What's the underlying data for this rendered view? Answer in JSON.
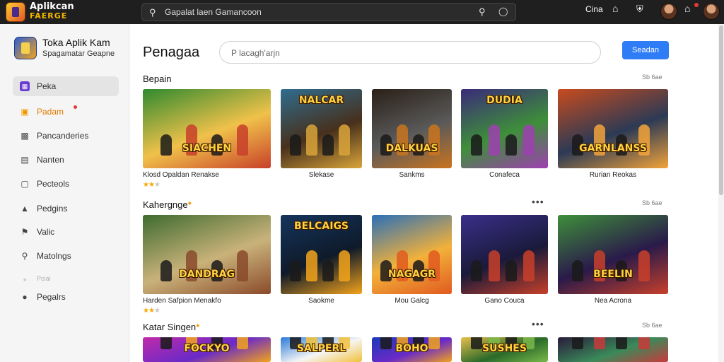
{
  "topbar": {
    "brand_line1": "Aplikcan",
    "brand_line2": "FAERGE",
    "search_text": "Gapalat laen Gamancoon",
    "right_label": "Cina"
  },
  "sidebar": {
    "app_name": "Toka Aplik Kam",
    "app_subtitle": "Spagamatar Geapne",
    "items": [
      {
        "label": "Peka",
        "icon": "grid-icon"
      },
      {
        "label": "Padam",
        "icon": "fire-icon"
      },
      {
        "label": "Pancanderies",
        "icon": "folder-icon"
      },
      {
        "label": "Nanten",
        "icon": "calendar-icon"
      },
      {
        "label": "Pecteols",
        "icon": "document-icon"
      },
      {
        "label": "Pedgins",
        "icon": "puzzle-icon"
      },
      {
        "label": "Valic",
        "icon": "flag-icon"
      },
      {
        "label": "Matolngs",
        "icon": "search-icon"
      },
      {
        "label": "Pcial",
        "icon": "circle-icon"
      },
      {
        "label": "Pegalrs",
        "icon": "settings-icon"
      }
    ]
  },
  "main": {
    "page_title": "Penagaa",
    "search_placeholder": "P lacagh'arjn",
    "search_button": "Seadan",
    "sections": [
      {
        "title": "Bepain",
        "see_all": "Sb 6ae",
        "more": "",
        "cards": [
          {
            "art_title": "SIACHEN",
            "label": "Klosd Opaldan Renakse",
            "rating": 2,
            "colors": [
              "#2f8a2f",
              "#c8402a",
              "#f0c14a"
            ]
          },
          {
            "art_title": "NALCAR",
            "label": "Slekase",
            "rating": 0,
            "colors": [
              "#2f6d8f",
              "#d9a43a",
              "#47301c"
            ]
          },
          {
            "art_title": "DALKUAS",
            "label": "Sankms",
            "rating": 0,
            "colors": [
              "#2a2018",
              "#c9741f",
              "#5a5a5a"
            ]
          },
          {
            "art_title": "DUDIA",
            "label": "Conafeca",
            "rating": 0,
            "colors": [
              "#3a2a7a",
              "#9e3fb0",
              "#3e8f3a"
            ]
          },
          {
            "art_title": "GARNLANSS",
            "label": "Rurian Reokas",
            "rating": 0,
            "colors": [
              "#c84b1e",
              "#f2a33a",
              "#2c3a55"
            ]
          }
        ]
      },
      {
        "title": "Kahergnge",
        "see_all": "Sb 6ae",
        "more": "•••",
        "cards": [
          {
            "art_title": "DANDRAG",
            "label": "Harden Safpion Menakfo",
            "rating": 2,
            "colors": [
              "#3e6b2f",
              "#8a4a2a",
              "#c9b27a"
            ]
          },
          {
            "art_title": "BELCAIGS",
            "label": "Saokme",
            "rating": 0,
            "colors": [
              "#14355c",
              "#f2a31b",
              "#0f1a2a"
            ]
          },
          {
            "art_title": "NAGAGR",
            "label": "Mou Galcg",
            "rating": 0,
            "colors": [
              "#2a6fb8",
              "#e05a1f",
              "#f2b13a"
            ]
          },
          {
            "art_title": "",
            "label": "Gano Couca",
            "rating": 0,
            "colors": [
              "#3a2f8a",
              "#c8402a",
              "#1a1a3a"
            ]
          },
          {
            "art_title": "BEELIN",
            "label": "Nea Acrona",
            "rating": 0,
            "colors": [
              "#3e8f3a",
              "#c8402a",
              "#2a1a4a"
            ]
          }
        ]
      },
      {
        "title": "Katar Singen",
        "see_all": "Sb 6ae",
        "more": "•••",
        "cards": [
          {
            "art_title": "FOCKYO",
            "label": "",
            "rating": 0,
            "colors": [
              "#c02aa8",
              "#f2a31b",
              "#6a2ac8"
            ]
          },
          {
            "art_title": "SALPERL",
            "label": "",
            "rating": 0,
            "colors": [
              "#2a7ad8",
              "#f2c13a",
              "#f5f5f5"
            ]
          },
          {
            "art_title": "BOHO",
            "label": "",
            "rating": 0,
            "colors": [
              "#1a3ab8",
              "#f2a31b",
              "#6a2ac8"
            ]
          },
          {
            "art_title": "SUSHES",
            "label": "",
            "rating": 0,
            "colors": [
              "#e8c04a",
              "#7ab84a",
              "#2a6a2a"
            ]
          },
          {
            "art_title": "",
            "label": "",
            "rating": 0,
            "colors": [
              "#2a1a3a",
              "#c83a3a",
              "#3a8a5a"
            ]
          }
        ]
      }
    ]
  },
  "colors": {
    "accent": "#2f7df6",
    "topbar_bg": "#1f1f1f",
    "sidebar_bg": "#f5f5f5",
    "active_item": "#6a3bd1",
    "hot_item": "#f29900",
    "star": "#f5a800"
  }
}
